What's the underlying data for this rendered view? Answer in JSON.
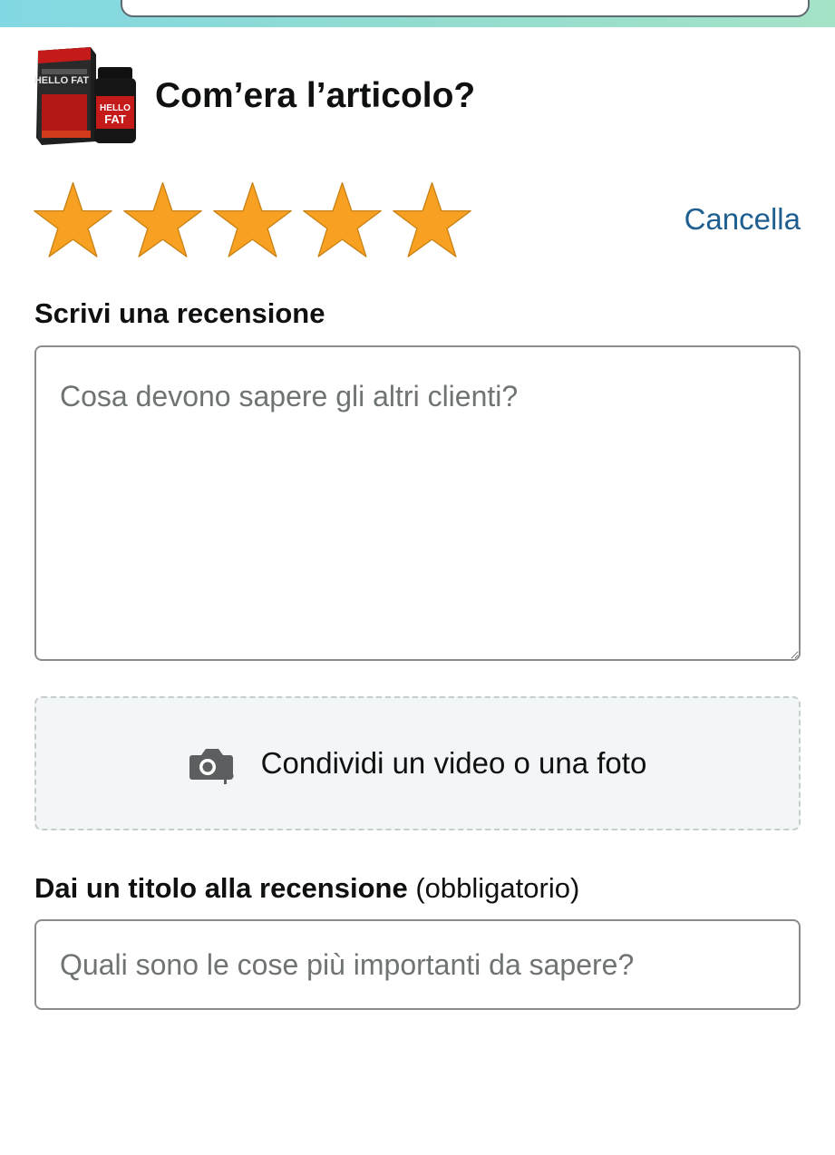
{
  "header": {
    "question": "Com’era l’articolo?",
    "product_image": "product-box-and-bottle-image",
    "product_brand_text": "HELLO FAT"
  },
  "rating": {
    "value": 5,
    "max": 5,
    "star_color": "#f7a021",
    "clear_label": "Cancella"
  },
  "review": {
    "label": "Scrivi una recensione",
    "placeholder": "Cosa devono sapere gli altri clienti?",
    "value": ""
  },
  "media": {
    "label": "Condividi un video o una foto",
    "icon": "camera-plus-icon"
  },
  "title": {
    "label": "Dai un titolo alla recensione",
    "required_note": "(obbligatorio)",
    "placeholder": "Quali sono le cose più importanti da sapere?",
    "value": ""
  },
  "colors": {
    "link": "#1f5f8f",
    "text": "#0f1111",
    "topbar_gradient": [
      "#82d8e3",
      "#a5e3c7"
    ]
  }
}
